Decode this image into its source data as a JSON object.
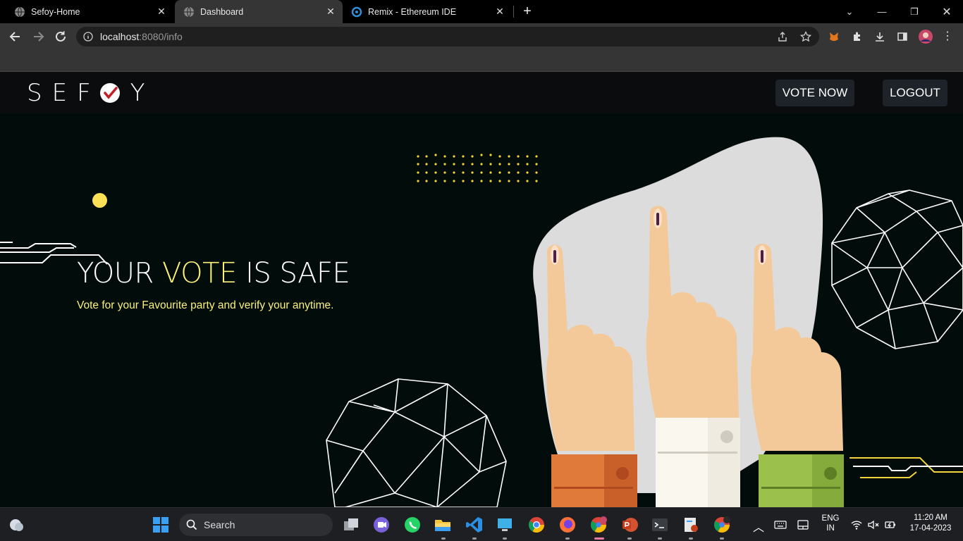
{
  "browser": {
    "tabs": [
      {
        "title": "Sefoy-Home"
      },
      {
        "title": "Dashboard"
      },
      {
        "title": "Remix - Ethereum IDE"
      }
    ],
    "new_tab": "+",
    "url_host": "localhost",
    "url_rest": ":8080/info"
  },
  "site": {
    "logo_left": "SEF",
    "logo_right": "Y",
    "nav": {
      "vote_now": "VOTE NOW",
      "logout": "LOGOUT"
    },
    "hero": {
      "title_part1": "YOUR ",
      "title_highlight": "VOTE",
      "title_part2": " IS SAFE",
      "subtitle": "Vote for your Favourite party and verify your anytime."
    },
    "colors": {
      "accent_yellow": "#fbf17a",
      "background": "#020d0b"
    }
  },
  "taskbar": {
    "search_label": "Search",
    "language_top": "ENG",
    "language_bottom": "IN",
    "time": "11:20 AM",
    "date": "17-04-2023"
  }
}
